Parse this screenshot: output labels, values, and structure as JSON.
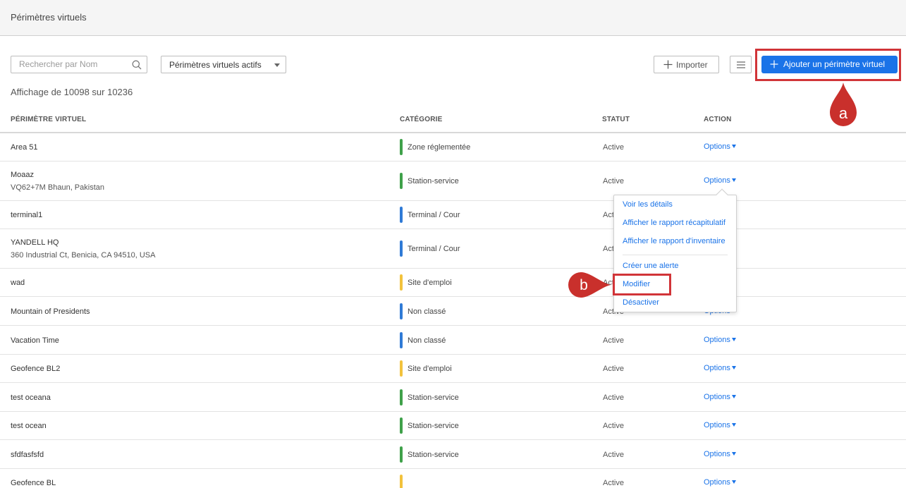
{
  "header": {
    "title": "Périmètres virtuels"
  },
  "toolbar": {
    "search_placeholder": "Rechercher par Nom",
    "filter_selected": "Périmètres virtuels actifs",
    "import_label": "Importer",
    "add_label": "Ajouter un périmètre virtuel"
  },
  "count_text": "Affichage de 10098 sur 10236",
  "columns": {
    "name": "PÉRIMÈTRE VIRTUEL",
    "category": "CATÉGORIE",
    "status": "STATUT",
    "action": "ACTION"
  },
  "rows": [
    {
      "name": "Area 51",
      "address": "",
      "category": "Zone réglementée",
      "category_color": "#3fa14a",
      "status": "Active",
      "action": "Options"
    },
    {
      "name": "Moaaz",
      "address": "VQ62+7M Bhaun, Pakistan",
      "category": "Station-service",
      "category_color": "#3fa14a",
      "status": "Active",
      "action": "Options"
    },
    {
      "name": "terminal1",
      "address": "",
      "category": "Terminal / Cour",
      "category_color": "#2f7ad6",
      "status": "Active",
      "action": "Options"
    },
    {
      "name": "YANDELL HQ",
      "address": "360 Industrial Ct, Benicia, CA 94510, USA",
      "category": "Terminal / Cour",
      "category_color": "#2f7ad6",
      "status": "Active",
      "action": "Options"
    },
    {
      "name": "wad",
      "address": "",
      "category": "Site d'emploi",
      "category_color": "#f2c23c",
      "status": "Active",
      "action": "Options"
    },
    {
      "name": "Mountain of Presidents",
      "address": "",
      "category": "Non classé",
      "category_color": "#2f7ad6",
      "status": "Active",
      "action": "Options"
    },
    {
      "name": "Vacation Time",
      "address": "",
      "category": "Non classé",
      "category_color": "#2f7ad6",
      "status": "Active",
      "action": "Options"
    },
    {
      "name": "Geofence BL2",
      "address": "",
      "category": "Site d'emploi",
      "category_color": "#f2c23c",
      "status": "Active",
      "action": "Options"
    },
    {
      "name": "test oceana",
      "address": "",
      "category": "Station-service",
      "category_color": "#3fa14a",
      "status": "Active",
      "action": "Options"
    },
    {
      "name": "test ocean",
      "address": "",
      "category": "Station-service",
      "category_color": "#3fa14a",
      "status": "Active",
      "action": "Options"
    },
    {
      "name": "sfdfasfsfd",
      "address": "",
      "category": "Station-service",
      "category_color": "#3fa14a",
      "status": "Active",
      "action": "Options"
    },
    {
      "name": "Geofence BL",
      "address": "",
      "category": "",
      "category_color": "#f2c23c",
      "status": "Active",
      "action": "Options"
    }
  ],
  "dropdown": {
    "items": [
      "Voir les détails",
      "Afficher le rapport récapitulatif",
      "Afficher le rapport d'inventaire",
      "Créer une alerte",
      "Modifier",
      "Désactiver"
    ]
  },
  "markers": {
    "a": "a",
    "b": "b"
  },
  "colors": {
    "accent": "#1a73e8",
    "highlight": "#d13438"
  }
}
